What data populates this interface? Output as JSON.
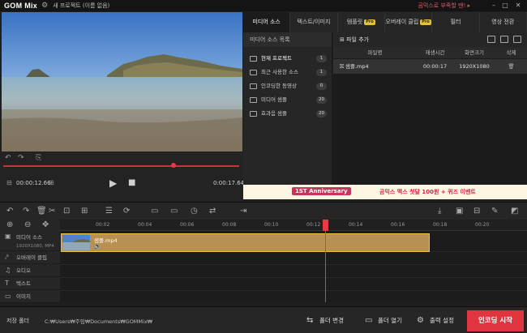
{
  "titlebar": {
    "logo": "GOM Mix",
    "project_title": "새 프로젝트 (이름 없음)",
    "promo": "곰믹스로 부족할 땐!",
    "promo_arrow": "▸"
  },
  "preview": {
    "current_time": "00:00:12.66",
    "total_time": "0:00:17.64",
    "seek_progress": 0.72
  },
  "tabs": [
    {
      "label": "미디어 소스",
      "active": true,
      "pro": false
    },
    {
      "label": "텍스트/이미지",
      "active": false,
      "pro": false
    },
    {
      "label": "템플릿",
      "active": false,
      "pro": true
    },
    {
      "label": "오버레이 클립",
      "active": false,
      "pro": true
    },
    {
      "label": "필터",
      "active": false,
      "pro": false
    },
    {
      "label": "영상 전환",
      "active": false,
      "pro": false
    }
  ],
  "pro_badge": "Pro",
  "folder_panel": {
    "header": "미디어 소스 목록",
    "items": [
      {
        "label": "현재 프로젝트",
        "count": "1",
        "active": true
      },
      {
        "label": "최근 사용한 소스",
        "count": "1",
        "active": false
      },
      {
        "label": "인코딩한 동영상",
        "count": "0",
        "active": false
      },
      {
        "label": "미디어 샘플",
        "count": "20",
        "active": false
      },
      {
        "label": "효과음 샘플",
        "count": "20",
        "active": false
      }
    ]
  },
  "file_panel": {
    "add_file": "파일 추가",
    "columns": [
      "파일명",
      "재생시간",
      "화면크기",
      "삭제"
    ],
    "rows": [
      {
        "name": "샘플.mp4",
        "duration": "00:00:17",
        "size": "1920X1080"
      }
    ]
  },
  "banner": {
    "left_text": "1ST Anniversary",
    "right_text": "곰믹스 맥스 첫달 100원 + 퀴즈 이벤트"
  },
  "timeline": {
    "ticks": [
      "00:02",
      "00:04",
      "00:06",
      "00:08",
      "00:10",
      "00:12",
      "00:14",
      "00:16",
      "00:18",
      "00:20"
    ],
    "tracks": [
      {
        "label": "미디어 소스",
        "sub": "1920X1080, MP4"
      },
      {
        "label": "오버레이 클립",
        "sub": ""
      },
      {
        "label": "오디오",
        "sub": ""
      },
      {
        "label": "텍스트",
        "sub": ""
      },
      {
        "label": "이미지",
        "sub": ""
      }
    ],
    "clip_label": "샘플.mp4"
  },
  "bottombar": {
    "save_label": "저장 폴더",
    "save_path": "C:₩Users₩주임₩Documents₩GOMMix₩",
    "change_folder": "폴더 변경",
    "open_folder": "폴더 열기",
    "output_settings": "출력 설정",
    "encode": "인코딩 시작"
  },
  "colors": {
    "accent": "#e0343f",
    "clip": "#b89053",
    "pro": "#e6c23b"
  }
}
